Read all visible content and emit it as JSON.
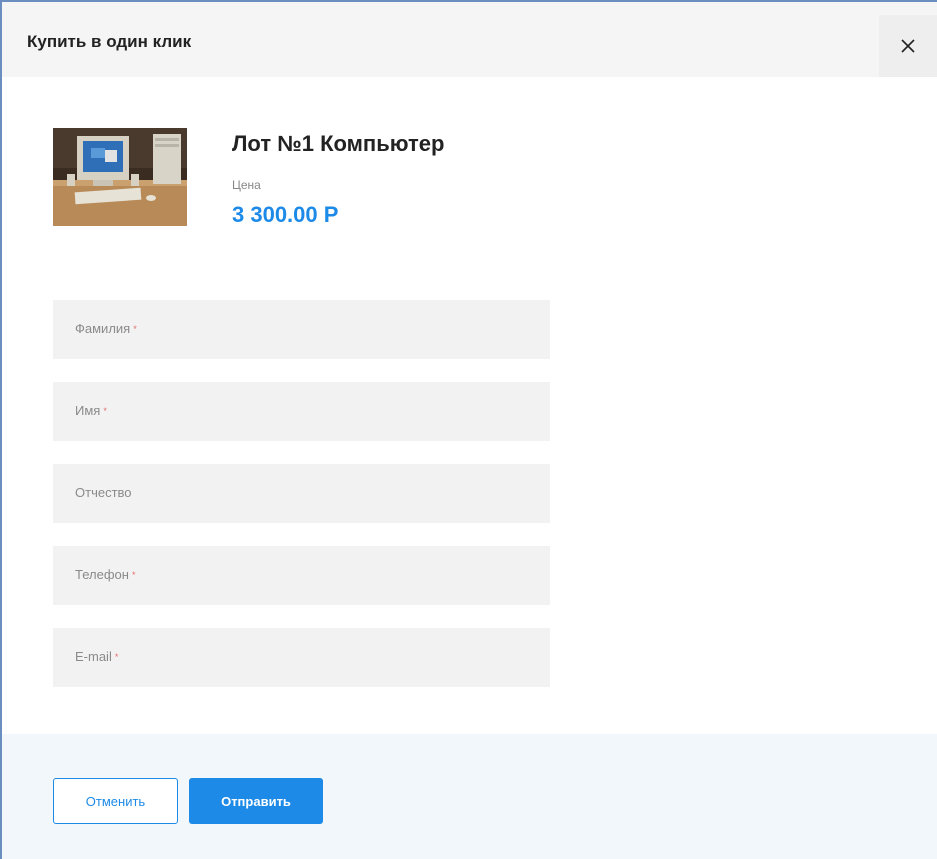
{
  "modal": {
    "title": "Купить в один клик",
    "close_icon": "close-icon"
  },
  "product": {
    "name": "Лот №1 Компьютер",
    "price_label": "Цена",
    "price_value": "3 300.00 Р"
  },
  "form": {
    "fields": [
      {
        "label": "Фамилия",
        "required": true
      },
      {
        "label": "Имя",
        "required": true
      },
      {
        "label": "Отчество",
        "required": false
      },
      {
        "label": "Телефон",
        "required": true
      },
      {
        "label": "E-mail",
        "required": true
      }
    ],
    "required_mark": "*"
  },
  "footer": {
    "cancel_label": "Отменить",
    "submit_label": "Отправить"
  },
  "colors": {
    "accent": "#1d8ae8",
    "required": "#e46d6d",
    "header_bg": "#f5f5f5",
    "field_bg": "#f2f2f2",
    "footer_bg": "#f2f7fc"
  }
}
